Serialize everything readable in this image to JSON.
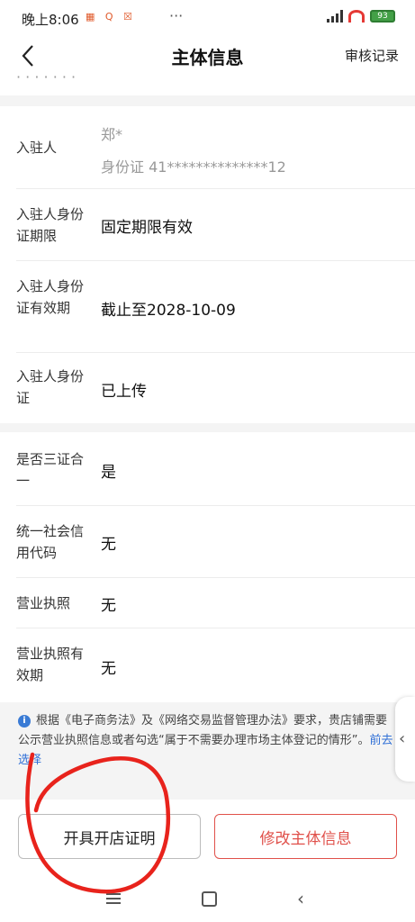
{
  "status_bar": {
    "time": "晚上8:06",
    "icons": "▦ Q ☒",
    "dots": "···",
    "battery": "93"
  },
  "nav": {
    "title": "主体信息",
    "right_link": "审核记录"
  },
  "section_top": {
    "partial_text": "· · ·  · · · ·"
  },
  "section_person": {
    "rows": [
      {
        "label": "入驻人",
        "value_line1": "郑*",
        "value_line2": "身份证 41**************12"
      },
      {
        "label": "入驻人身份证期限",
        "value": "固定期限有效"
      },
      {
        "label": "入驻人身份证有效期",
        "value": "截止至2028-10-09"
      },
      {
        "label": "入驻人身份证",
        "value": "已上传"
      }
    ]
  },
  "section_license": {
    "rows": [
      {
        "label": "是否三证合一",
        "value": "是"
      },
      {
        "label": "统一社会信用代码",
        "value": "无"
      },
      {
        "label": "营业执照",
        "value": "无"
      },
      {
        "label": "营业执照有效期",
        "value": "无"
      }
    ]
  },
  "notice": {
    "text": "根据《电子商务法》及《网络交易监督管理办法》要求，贵店铺需要公示营业执照信息或者勾选“属于不需要办理市场主体登记的情形”。",
    "link": "前去选择"
  },
  "buttons": {
    "left": "开具开店证明",
    "right": "修改主体信息"
  },
  "colors": {
    "accent_red": "#e0504a",
    "link_blue": "#2f6fd6",
    "annotation_red": "#e8231c"
  }
}
